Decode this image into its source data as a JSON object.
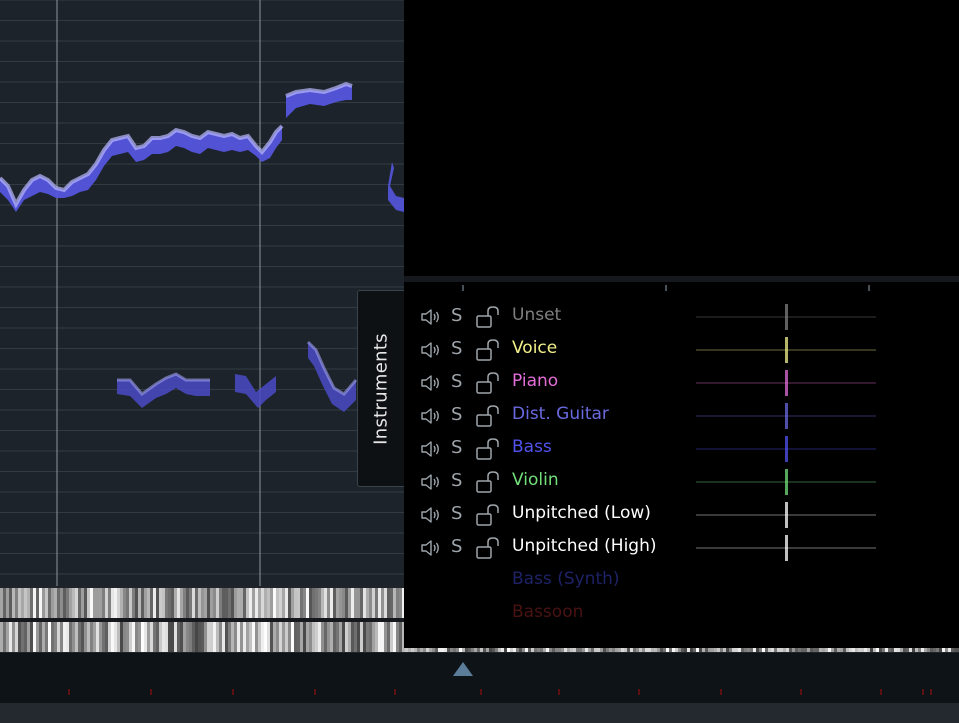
{
  "panel": {
    "tab_label": "Instruments",
    "solo_label": "S"
  },
  "instruments": [
    {
      "name": "Unset",
      "color": "#7f7f7f",
      "active": true
    },
    {
      "name": "Voice",
      "color": "#f2f08a",
      "active": true
    },
    {
      "name": "Piano",
      "color": "#e36ed8",
      "active": true
    },
    {
      "name": "Dist. Guitar",
      "color": "#6a6ae0",
      "active": true
    },
    {
      "name": "Bass",
      "color": "#5252f0",
      "active": true
    },
    {
      "name": "Violin",
      "color": "#72e07a",
      "active": true
    },
    {
      "name": "Unpitched (Low)",
      "color": "#ffffff",
      "active": true
    },
    {
      "name": "Unpitched (High)",
      "color": "#ffffff",
      "active": true
    },
    {
      "name": "Bass (Synth)",
      "color": "#1e2266",
      "active": false
    },
    {
      "name": "Bassoon",
      "color": "#4a1212",
      "active": false
    }
  ],
  "colors": {
    "blob_fill": "#5555dd",
    "blob_highlight": "#b9b9ff",
    "editor_bg": "#1c232a",
    "grid_line": "#323b44",
    "timeline_tick": "#5a1111"
  }
}
